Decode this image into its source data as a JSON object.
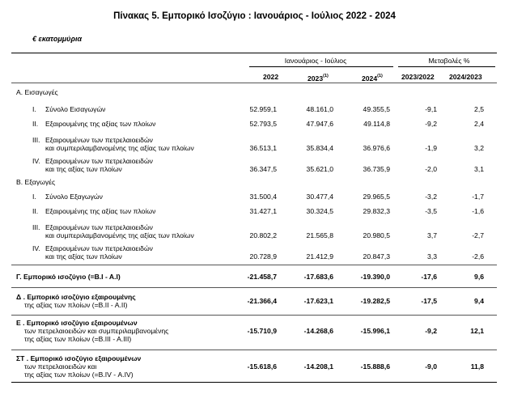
{
  "title": "Πίνακας 5. Εμπορικό Ισοζύγιο : Ιανουάριος - Ιούλιος 2022 - 2024",
  "unit": "€ εκατομμύρια",
  "header": {
    "period_group": "Ιανουάριος - Ιούλιος",
    "change_group": "Μεταβολές %",
    "col_2022": "2022",
    "col_2023": "2023",
    "col_2023_sup": "(1)",
    "col_2024": "2024",
    "col_2024_sup": "(1)",
    "col_ch1": "2023/2022",
    "col_ch2": "2024/2023"
  },
  "sections": {
    "imports": "Α. Εισαγωγές",
    "exports": "Β. Εξαγωγές"
  },
  "rows": [
    {
      "num": "I.",
      "l1": "Σύνολο Εισαγωγών",
      "l2": "",
      "v2022": "52.959,1",
      "v2023": "48.161,0",
      "v2024": "49.355,5",
      "c1": "-9,1",
      "c2": "2,5"
    },
    {
      "num": "II.",
      "l1": "Εξαιρουμένης  της αξίας των πλοίων",
      "l2": "",
      "v2022": "52.793,5",
      "v2023": "47.947,6",
      "v2024": "49.114,8",
      "c1": "-9,2",
      "c2": "2,4"
    },
    {
      "num": "III.",
      "l1": "Εξαιρουμένων των πετρελαιοειδών",
      "l2": "και συμπεριλαμβανομένης της αξίας των πλοίων",
      "v2022": "36.513,1",
      "v2023": "35.834,4",
      "v2024": "36.976,6",
      "c1": "-1,9",
      "c2": "3,2"
    },
    {
      "num": "IV.",
      "l1": "Εξαιρουμένων των πετρελαιοειδών",
      "l2": "και  της αξίας των πλοίων",
      "v2022": "36.347,5",
      "v2023": "35.621,0",
      "v2024": "36.735,9",
      "c1": "-2,0",
      "c2": "3,1"
    },
    {
      "num": "I.",
      "l1": "Σύνολο Εξαγωγών",
      "l2": "",
      "v2022": "31.500,4",
      "v2023": "30.477,4",
      "v2024": "29.965,5",
      "c1": "-3,2",
      "c2": "-1,7"
    },
    {
      "num": "II.",
      "l1": "Εξαιρουμένης  της αξίας των πλοίων",
      "l2": "",
      "v2022": "31.427,1",
      "v2023": "30.324,5",
      "v2024": "29.832,3",
      "c1": "-3,5",
      "c2": "-1,6"
    },
    {
      "num": "III.",
      "l1": "Εξαιρουμένων των πετρελαιοειδών",
      "l2": "και συμπεριλαμβανομένης της αξίας των πλοίων",
      "v2022": "20.802,2",
      "v2023": "21.565,8",
      "v2024": "20.980,5",
      "c1": "3,7",
      "c2": "-2,7"
    },
    {
      "num": "IV.",
      "l1": "Εξαιρουμένων των πετρελαιοειδών",
      "l2": "και  της αξίας των πλοίων",
      "v2022": "20.728,9",
      "v2023": "21.412,9",
      "v2024": "20.847,3",
      "c1": "3,3",
      "c2": "-2,6"
    }
  ],
  "balances": [
    {
      "l1": "Γ. Εμπορικό ισοζύγιο (=Β.Ι - Α.Ι)",
      "l2": "",
      "l3": "",
      "v2022": "-21.458,7",
      "v2023": "-17.683,6",
      "v2024": "-19.390,0",
      "c1": "-17,6",
      "c2": "9,6"
    },
    {
      "l1": "Δ . Εμπορικό ισοζύγιο εξαιρουμένης",
      "l2": "της αξίας των πλοίων (=Β.ΙΙ - Α.ΙΙ)",
      "l3": "",
      "v2022": "-21.366,4",
      "v2023": "-17.623,1",
      "v2024": "-19.282,5",
      "c1": "-17,5",
      "c2": "9,4"
    },
    {
      "l1": "Ε . Εμπορικό ισοζύγιο εξαιρουμένων",
      "l2": "των πετρελαιοειδών και συμπεριλαμβανομένης",
      "l3": "της αξίας των πλοίων (=Β.ΙΙΙ - Α.ΙΙΙ)",
      "v2022": "-15.710,9",
      "v2023": "-14.268,6",
      "v2024": "-15.996,1",
      "c1": "-9,2",
      "c2": "12,1"
    },
    {
      "l1": "ΣΤ . Εμπορικό ισοζύγιο εξαιρουμένων",
      "l2": "των πετρελαιοειδών και",
      "l3": "της αξίας των πλοίων (=Β.IV - Α.IV)",
      "v2022": "-15.618,6",
      "v2023": "-14.208,1",
      "v2024": "-15.888,6",
      "c1": "-9,0",
      "c2": "11,8"
    }
  ]
}
